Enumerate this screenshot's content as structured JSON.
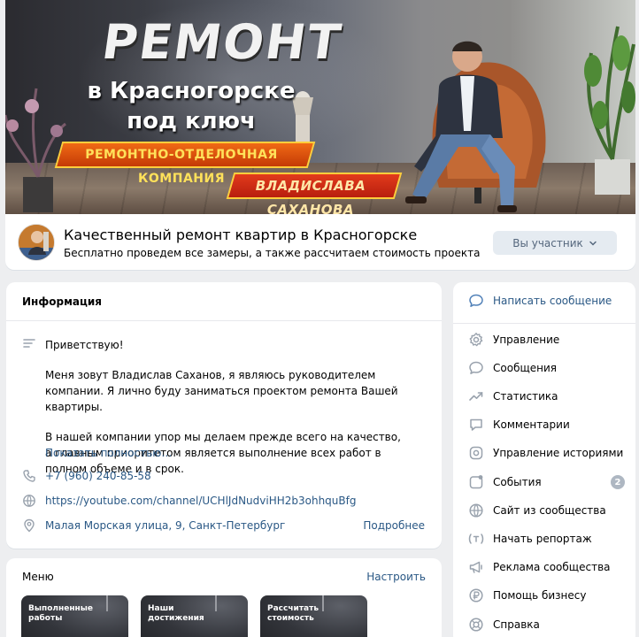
{
  "cover": {
    "title": "РЕМОНТ",
    "subtitle_line1": "в Красногорске",
    "subtitle_line2": "под ключ",
    "banner1": "РЕМОНТНО-ОТДЕЛОЧНАЯ КОМПАНИЯ",
    "banner2": "ВЛАДИСЛАВА САХАНОВА"
  },
  "group": {
    "title": "Качественный ремонт квартир в Красногорске",
    "status": "Бесплатно проведем все замеры, а также рассчитаем стоимость проекта",
    "member_button": "Вы участник"
  },
  "info": {
    "heading": "Информация",
    "description": [
      "Приветствую!",
      "Меня зовут Владислав Саханов, я являюсь руководителем компании. Я лично буду заниматься проектом ремонта Вашей квартиры.",
      "В нашей компании упор мы делаем прежде всего на качество, а главным приоритетом является выполнение всех работ в полном объеме и в срок."
    ],
    "show_more": "Показать полностью…",
    "phone": "+7 (960) 240-85-58",
    "website": "https://youtube.com/channel/UCHlJdNudviHH2b3ohhquBfg",
    "address": "Малая Морская улица, 9, Санкт-Петербург",
    "address_more": "Подробнее"
  },
  "menu": {
    "heading": "Меню",
    "configure": "Настроить",
    "tiles": [
      "Выполненные работы",
      "Наши достижения",
      "Рассчитать стоимость"
    ]
  },
  "sidebar": {
    "items": [
      {
        "label": "Написать сообщение",
        "icon": "message-icon"
      },
      {
        "label": "Управление",
        "icon": "gear-icon"
      },
      {
        "label": "Сообщения",
        "icon": "chat-icon"
      },
      {
        "label": "Статистика",
        "icon": "stats-icon"
      },
      {
        "label": "Комментарии",
        "icon": "comment-icon"
      },
      {
        "label": "Управление историями",
        "icon": "stories-icon"
      },
      {
        "label": "События",
        "icon": "events-icon",
        "badge": "2"
      },
      {
        "label": "Сайт из сообщества",
        "icon": "globe-icon"
      },
      {
        "label": "Начать репортаж",
        "icon": "broadcast-icon"
      },
      {
        "label": "Реклама сообщества",
        "icon": "megaphone-icon"
      },
      {
        "label": "Помощь бизнесу",
        "icon": "ruble-icon"
      },
      {
        "label": "Справка",
        "icon": "help-icon"
      }
    ]
  },
  "colors": {
    "link": "#2a5885",
    "icon": "#99a2ad",
    "background": "#edeef0",
    "button_bg": "#e5ebf1",
    "banner_orange": "#f06a15",
    "banner_red": "#e23b1c"
  }
}
